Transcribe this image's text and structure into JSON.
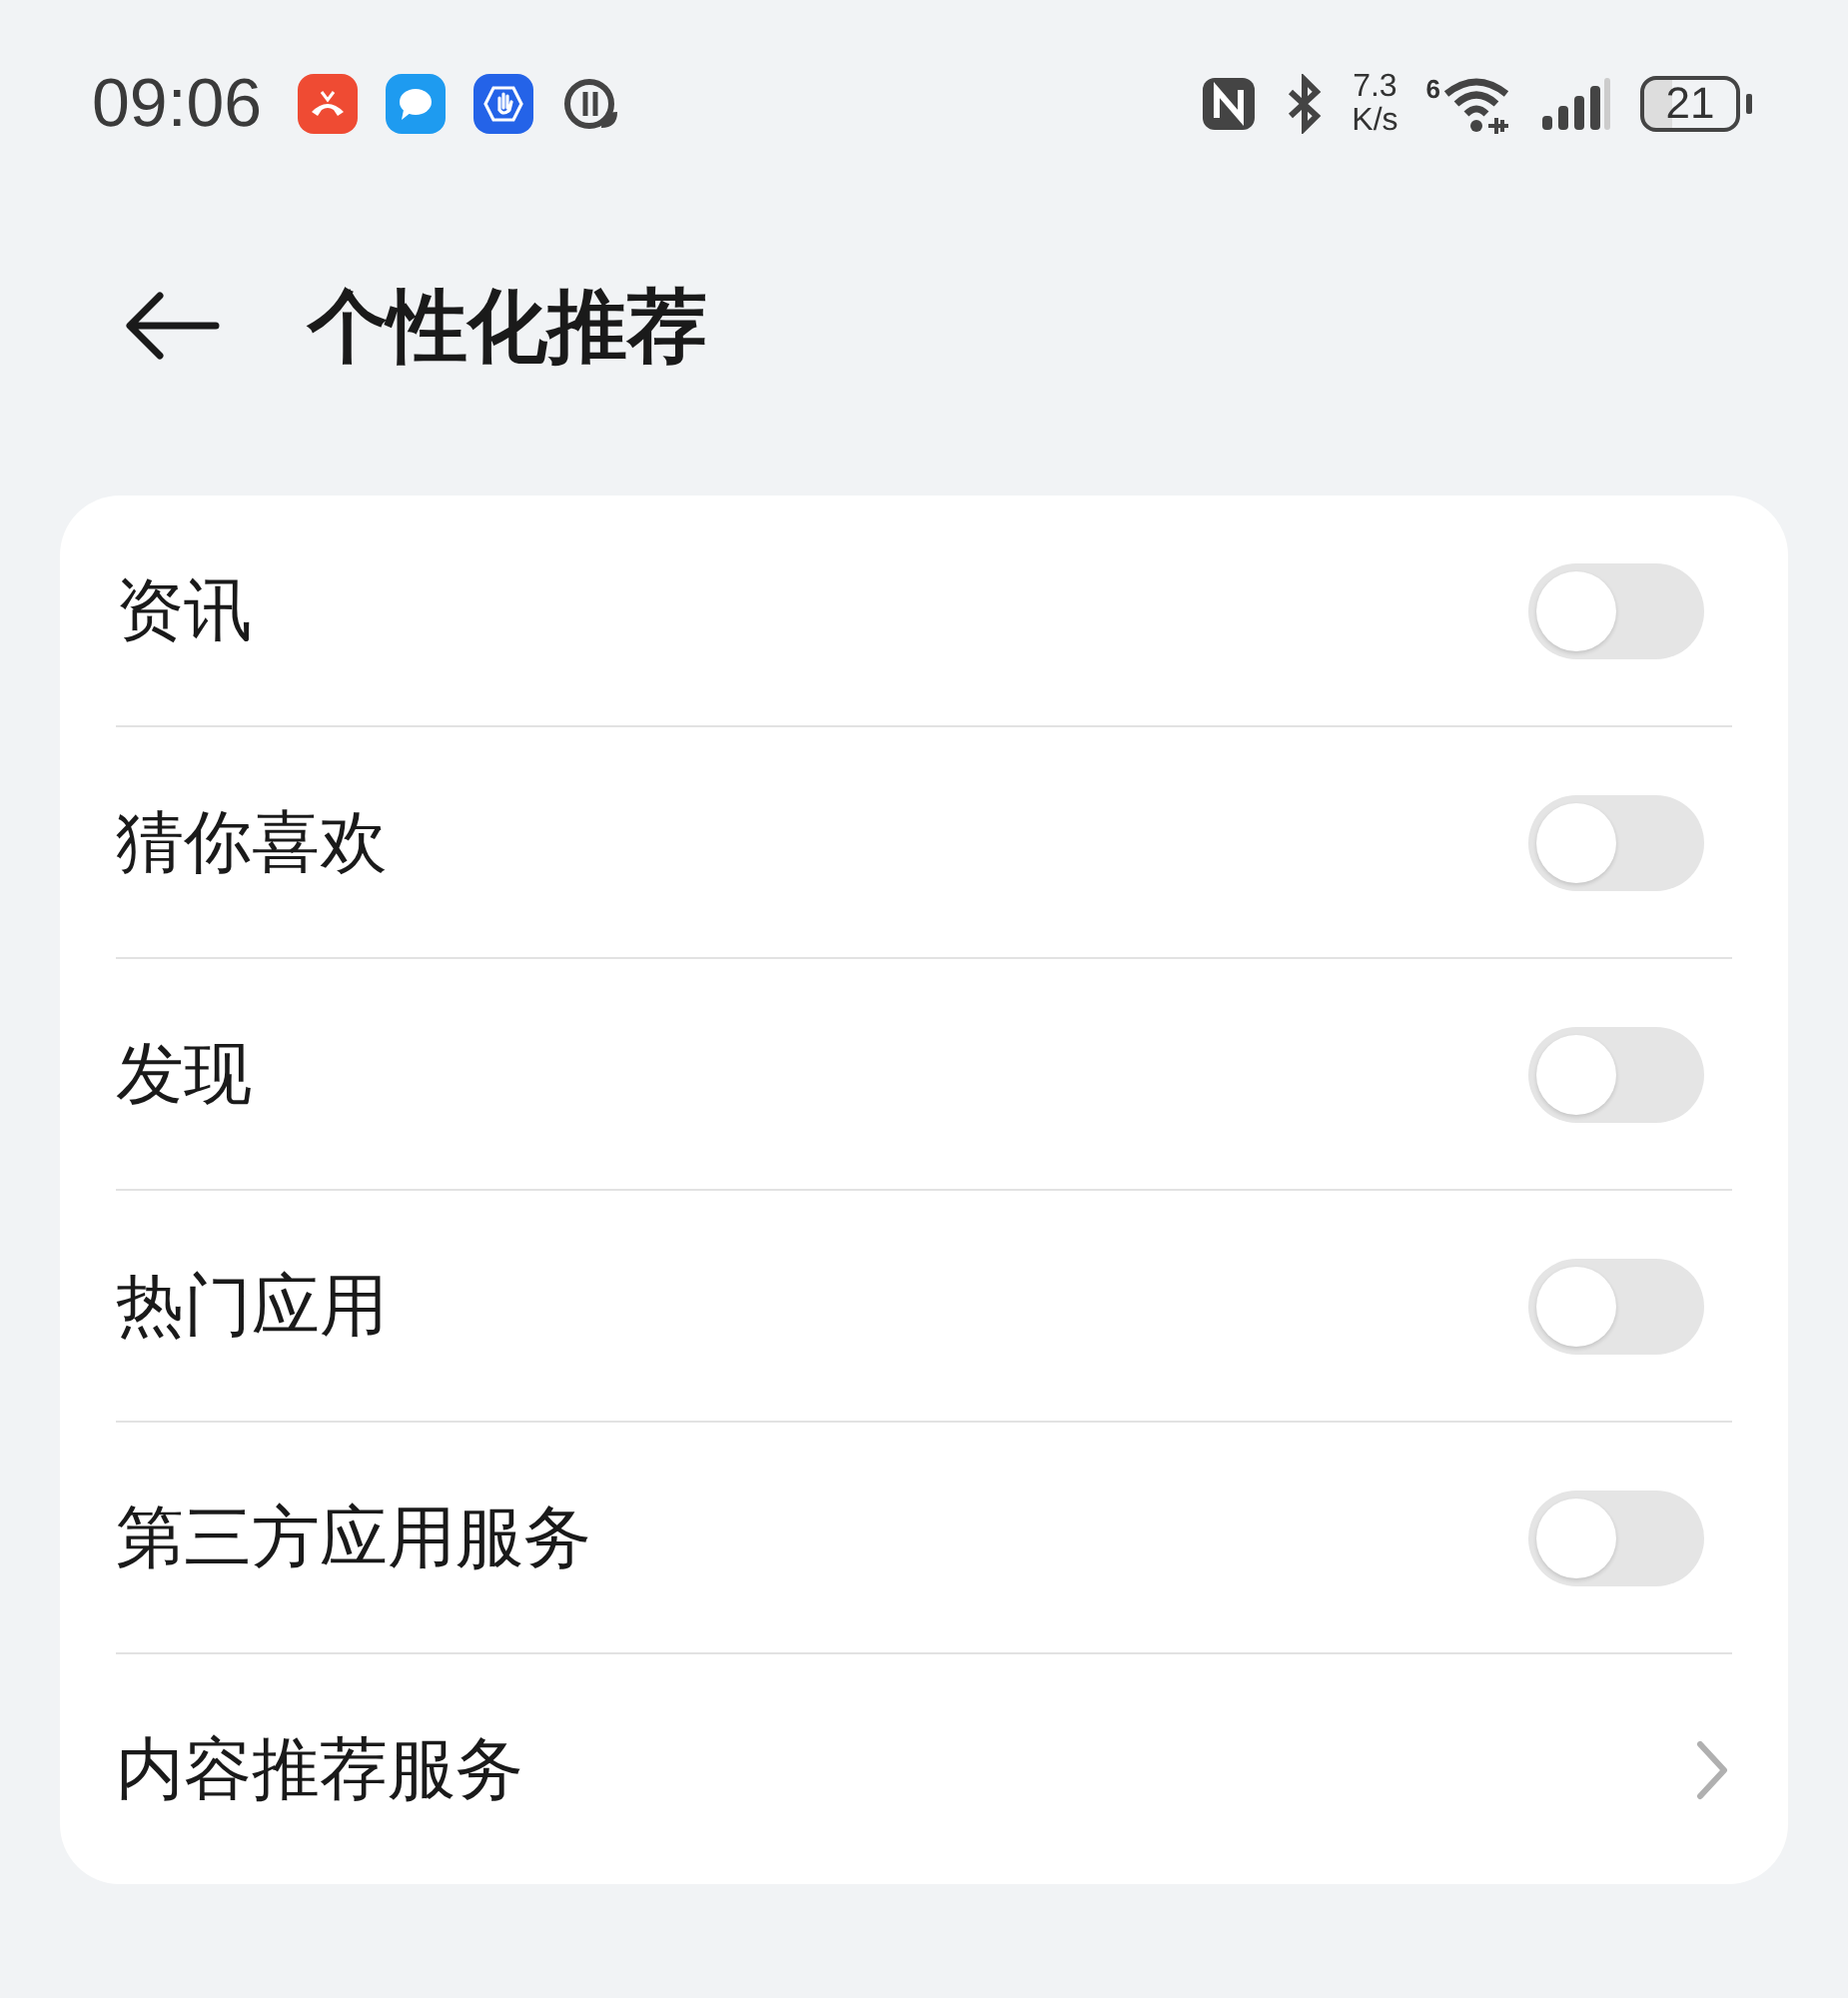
{
  "status_bar": {
    "time": "09:06",
    "speed_value": "7.3",
    "speed_unit": "K/s",
    "wifi_badge": "6",
    "battery": "21"
  },
  "header": {
    "title": "个性化推荐"
  },
  "items": [
    {
      "kind": "toggle",
      "label": "资讯",
      "on": false
    },
    {
      "kind": "toggle",
      "label": "猜你喜欢",
      "on": false
    },
    {
      "kind": "toggle",
      "label": "发现",
      "on": false
    },
    {
      "kind": "toggle",
      "label": "热门应用",
      "on": false
    },
    {
      "kind": "toggle",
      "label": "第三方应用服务",
      "on": false
    },
    {
      "kind": "link",
      "label": "内容推荐服务"
    }
  ]
}
